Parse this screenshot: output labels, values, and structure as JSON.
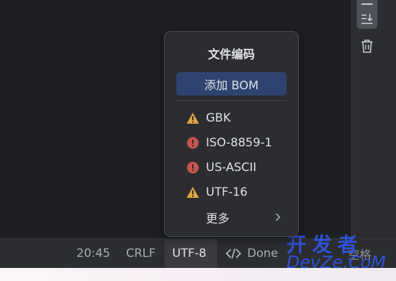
{
  "popup": {
    "title": "文件编码",
    "bom_button_label": "添加 BOM",
    "encodings": [
      {
        "label": "GBK",
        "status": "warning"
      },
      {
        "label": "ISO-8859-1",
        "status": "error"
      },
      {
        "label": "US-ASCII",
        "status": "error"
      },
      {
        "label": "UTF-16",
        "status": "warning"
      }
    ],
    "more_label": "更多"
  },
  "status_bar": {
    "position": "20:45",
    "line_separator": "CRLF",
    "encoding": "UTF-8",
    "code_status": "Done",
    "indent": "空格"
  },
  "right_toolbar": {
    "icons": [
      "scroll-to-end-icon",
      "trash-icon"
    ]
  },
  "watermark": {
    "cn": "开发者",
    "en": "DevZe.CoM"
  },
  "colors": {
    "background": "#1e1f22",
    "panel": "#2b2d30",
    "accent_button": "#2e4370",
    "warning": "#e0a543",
    "error": "#c75450",
    "watermark": "#2f52d6"
  }
}
